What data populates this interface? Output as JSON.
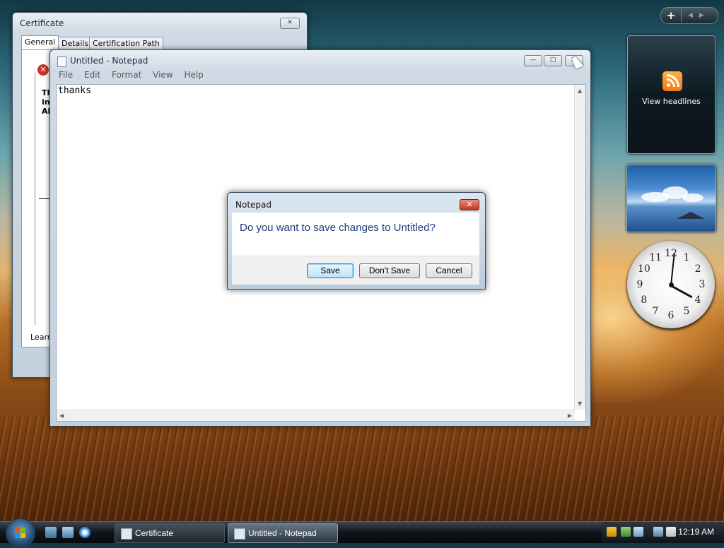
{
  "desktop": {
    "feed_gadget": {
      "label": "View headlines"
    },
    "clock_numbers": [
      "12",
      "1",
      "2",
      "3",
      "4",
      "5",
      "6",
      "7",
      "8",
      "9",
      "10",
      "11"
    ]
  },
  "certificate_window": {
    "title": "Certificate",
    "close": "✕",
    "tabs": [
      "General",
      "Details",
      "Certification Path"
    ],
    "partial_text": [
      "Th",
      "in",
      "Al"
    ],
    "learn": "Learn"
  },
  "notepad_window": {
    "title": "Untitled - Notepad",
    "menu": [
      "File",
      "Edit",
      "Format",
      "View",
      "Help"
    ],
    "content": "thanks"
  },
  "dialog": {
    "title": "Notepad",
    "message": "Do you want to save changes to Untitled?",
    "buttons": {
      "save": "Save",
      "dont_save": "Don't Save",
      "cancel": "Cancel"
    }
  },
  "taskbar": {
    "buttons": [
      "Certificate",
      "Untitled - Notepad"
    ],
    "time": "12:19 AM"
  }
}
